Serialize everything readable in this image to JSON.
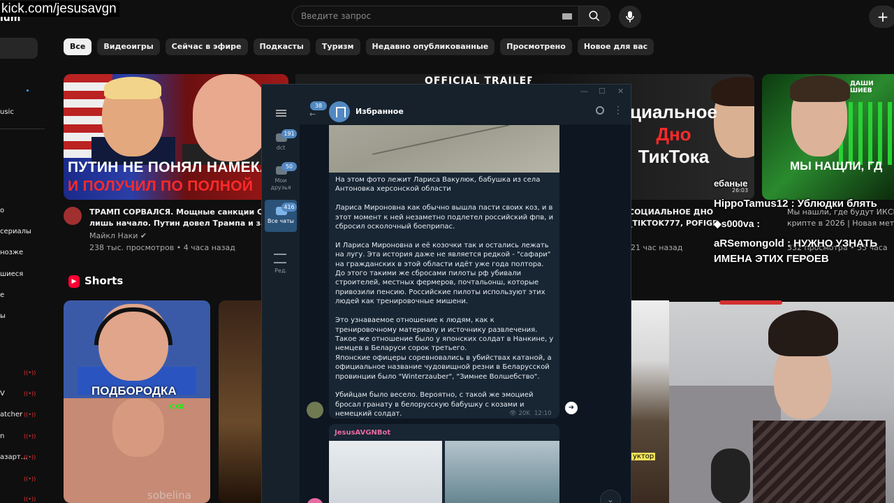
{
  "overlay": {
    "stream_url": "kick.com/jesusavgn",
    "logo_fragment": "ium"
  },
  "youtube": {
    "search": {
      "placeholder": "Введите запрос"
    },
    "sidebar": {
      "items": [
        "usic",
        "",
        "о",
        "сериалы",
        "нозже",
        "шиеся",
        "е",
        "ы",
        "V",
        "atcher",
        "n",
        "азарт..."
      ]
    },
    "chips": [
      "Все",
      "Видеоигры",
      "Сейчас в эфире",
      "Подкасты",
      "Туризм",
      "Недавно опубликованные",
      "Просмотрено",
      "Новое для вас"
    ],
    "videos": [
      {
        "thumb_line1": "ПУТИН НЕ ПОНЯЛ НАМЕКА",
        "thumb_line2": "И ПОЛУЧИЛ ПО ПОЛНОЙ",
        "title_line1": "ТРАМП СОРВАЛСЯ. Мощные санкции США",
        "title_line2": "лишь начало. Путин довел Трампа и запла",
        "channel": "Майкл Наки",
        "meta": "238 тыс. просмотров • 4 часа назад"
      },
      {
        "thumb_label": "OFFICIAL TRAILER"
      },
      {
        "thumb_line1": "циальное",
        "thumb_line2": "Дно",
        "thumb_line3": "ТикТока",
        "title_line1": "СОЦИАЛЬНОЕ ДНО",
        "title_line2": "_TIKTOK777, POFIGP",
        "meta": "21 час назад"
      },
      {
        "thumb_top": "ДАШИ ШИЕВ",
        "thumb_line": "МЫ НАЩЛИ, ГД",
        "title_line1": "Мы нашли, где будут ИКСЫ",
        "title_line2": "крипте в 2026 | Новая мета",
        "meta": "332 просмотра • 35 часа назад"
      }
    ],
    "shorts": {
      "title": "Shorts",
      "short1_label": "ПОДБОРОДКА",
      "short1_watermark": "sobelina",
      "short_mid_label": "уктор"
    }
  },
  "telegram": {
    "window_title": "Избранное",
    "back_badge": "38",
    "folders": [
      {
        "badge": "191",
        "label": "dct"
      },
      {
        "badge": "50",
        "label": "Мои друзья"
      },
      {
        "badge": "416",
        "label": "Все чаты"
      }
    ],
    "edit_label": "Ред.",
    "message": {
      "text": "На этом фото лежит Лариса Вакулюк, бабушка из села Антоновка херсонской области\n\nЛариса Мироновна как обычно вышла пасти своих коз, и в этот момент к ней незаметно подлетел российский фпв, и сбросил осколочный боеприпас.\n\nИ Лариса Мироновна и её козочки так и остались лежать на лугу. Эта история даже не является редкой - \"сафари\" на гражданских в этой области идёт уже года полтора. До этого такими же сбросами пилоты рф убивали строителей, местных фермеров, почтальонш, которые привозили пенсию. Российские пилоты используют этих людей как тренировочные мишени.\n\nЭто узнаваемое отношение к людям, как к тренировочному материалу и источнику развлечения. Такое же отношение было у японских солдат в Нанкине, у немцев в Беларуси сорок третьего.\nЯпонские офицеры соревновались в убийствах катаной, а официальное название чудовищной резни в Беларусской провинции было \"Winterzauber\", \"Зимнее Волшебство\".\n\nУбийцам было весело. Вероятно, с такой же эмоцией бросал гранату в белорусскую бабушку с козами и немецкий солдат.",
      "views": "20K",
      "time": "12:10"
    },
    "next_message": {
      "sender": "JesusAVGNBot"
    }
  },
  "stream_chat": [
    "ебаные",
    "HippoTamus12 : Ублюдки блять",
    "s000va :",
    "aRSemongold : НУЖНО УЗНАТЬ",
    "ИМЕНА ЭТИХ ГЕРОЕВ"
  ],
  "stream_chat_overlay_time": "26:03",
  "colors": {
    "accent_red": "#ff0033",
    "tg_accent": "#5288c1",
    "tg_bg": "#0e1621"
  }
}
